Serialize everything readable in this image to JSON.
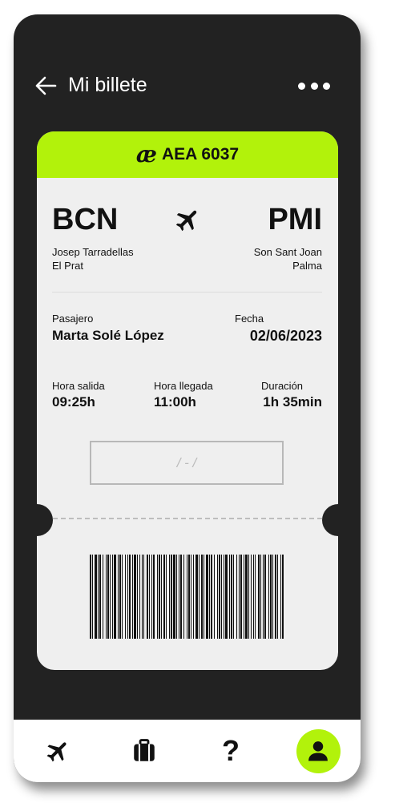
{
  "header": {
    "title": "Mi billete",
    "back_icon": "arrow-left-icon",
    "menu_icon": "more-dots-icon"
  },
  "ticket": {
    "accent_color": "#b2f20b",
    "airline_logo": "æ",
    "flight_number": "AEA 6037",
    "origin": {
      "code": "BCN",
      "airport_line1": "Josep Tarradellas",
      "airport_line2": "El Prat"
    },
    "destination": {
      "code": "PMI",
      "airport_line1": "Son Sant Joan",
      "airport_line2": "Palma"
    },
    "passenger": {
      "label": "Pasajero",
      "value": "Marta Solé López"
    },
    "date": {
      "label": "Fecha",
      "value": "02/06/2023"
    },
    "departure": {
      "label": "Hora salida",
      "value": "09:25h"
    },
    "arrival": {
      "label": "Hora llegada",
      "value": "11:00h"
    },
    "duration": {
      "label": "Duración",
      "value": "1h 35min"
    },
    "signature_placeholder": "/ - /"
  },
  "tabbar": {
    "items": [
      {
        "icon": "airplane-icon",
        "active": false
      },
      {
        "icon": "briefcase-icon",
        "active": false
      },
      {
        "icon": "question-icon",
        "glyph": "?",
        "active": false
      },
      {
        "icon": "user-icon",
        "active": true
      }
    ]
  }
}
